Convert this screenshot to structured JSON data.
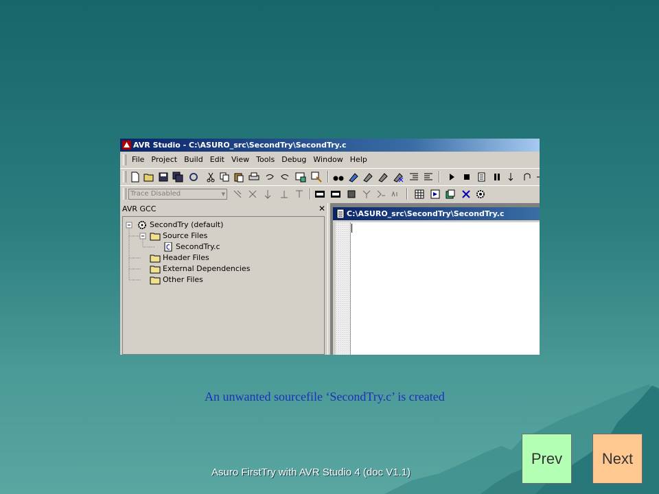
{
  "window": {
    "title": "AVR Studio - C:\\ASURO_src\\SecondTry\\SecondTry.c",
    "menu": [
      "File",
      "Project",
      "Build",
      "Edit",
      "View",
      "Tools",
      "Debug",
      "Window",
      "Help"
    ],
    "trace_select": {
      "value": "Trace Disabled"
    },
    "left_pane": {
      "title": "AVR GCC",
      "close_glyph": "✕",
      "tree": [
        {
          "label": "SecondTry (default)",
          "icon": "project-gear-icon"
        },
        {
          "label": "Source Files",
          "icon": "folder-icon"
        },
        {
          "label": "SecondTry.c",
          "icon": "c-file-icon"
        },
        {
          "label": "Header Files",
          "icon": "folder-icon"
        },
        {
          "label": "External Dependencies",
          "icon": "folder-icon"
        },
        {
          "label": "Other Files",
          "icon": "folder-icon"
        }
      ]
    },
    "document": {
      "title": "C:\\ASURO_src\\SecondTry\\SecondTry.c"
    }
  },
  "slide": {
    "caption": "An unwanted sourcefile ‘SecondTry.c’ is created",
    "footer": "Asuro FirstTry with AVR Studio 4 (doc V1.1)",
    "prev_label": "Prev",
    "next_label": "Next"
  },
  "colors": {
    "caption": "#1e2fb8",
    "prev_button": "#b3ffb3",
    "next_button": "#ffc890",
    "titlebar": "#0a246a"
  }
}
